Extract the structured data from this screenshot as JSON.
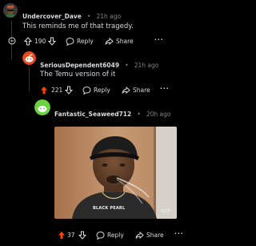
{
  "comments": [
    {
      "username": "Undercover_Dave",
      "time": "21h ago",
      "text": "This reminds me of that tragedy.",
      "votes": "190",
      "reply_label": "Reply",
      "share_label": "Share",
      "more_label": "···",
      "collapse_label": "⊖",
      "vote_state": "none"
    },
    {
      "username": "SeriousDependent6049",
      "time": "21h ago",
      "text": "The Temu version of it",
      "votes": "221",
      "reply_label": "Reply",
      "share_label": "Share",
      "more_label": "···",
      "vote_state": "upvoted"
    },
    {
      "username": "Fantastic_Seaweed712",
      "time": "20h ago",
      "media": {
        "type": "gif",
        "badge": "GIF",
        "shirt_text": "BLACK PEARL"
      },
      "votes": "37",
      "reply_label": "Reply",
      "share_label": "Share",
      "more_label": "···",
      "vote_state": "upvoted"
    }
  ],
  "separator": "•",
  "colors": {
    "background": "#000000",
    "text": "#d7dadc",
    "meta": "#818384",
    "upvote": "#ff4500",
    "thread_line": "#343536"
  }
}
